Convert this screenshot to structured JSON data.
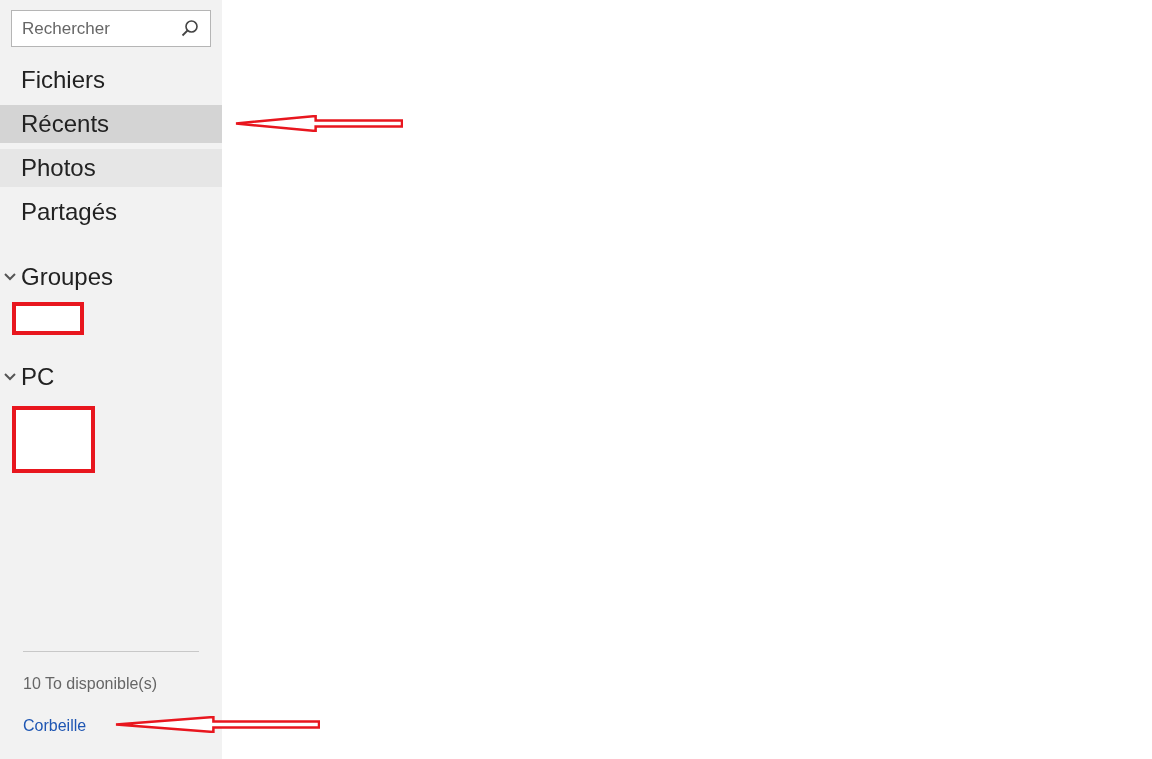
{
  "sidebar": {
    "search": {
      "placeholder": "Rechercher"
    },
    "items": [
      {
        "label": "Fichiers",
        "selected": false,
        "hovered": false
      },
      {
        "label": "Récents",
        "selected": true,
        "hovered": false
      },
      {
        "label": "Photos",
        "selected": false,
        "hovered": true
      },
      {
        "label": "Partagés",
        "selected": false,
        "hovered": false
      }
    ],
    "sections": [
      {
        "label": "Groupes",
        "expanded": true
      },
      {
        "label": "PC",
        "expanded": true
      }
    ],
    "storage": "10 To disponible(s)",
    "trash_link": "Corbeille"
  },
  "annotations": [
    {
      "kind": "arrow"
    },
    {
      "kind": "box"
    },
    {
      "kind": "box"
    },
    {
      "kind": "arrow"
    }
  ]
}
